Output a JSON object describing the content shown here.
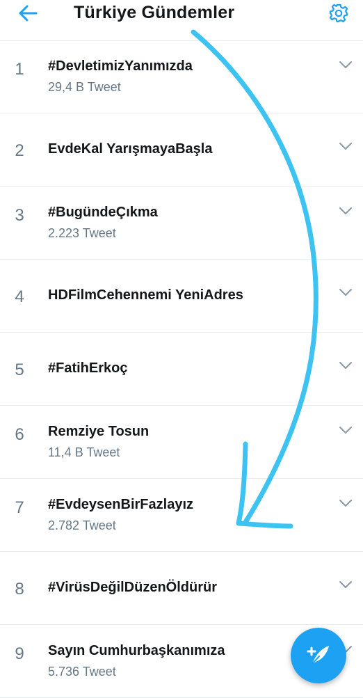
{
  "header": {
    "title": "Türkiye Gündemler",
    "back_icon": "back-arrow-icon",
    "settings_icon": "gear-icon"
  },
  "colors": {
    "accent": "#1da1f2",
    "annotation_stroke": "#3cc3f2",
    "primary_text": "#14171a",
    "secondary_text": "#657786",
    "divider": "#e6ecf0"
  },
  "trends": [
    {
      "rank": "1",
      "name": "#DevletimizYanımızda",
      "count": "29,4 B Tweet"
    },
    {
      "rank": "2",
      "name": "EvdeKal YarışmayaBaşla",
      "count": ""
    },
    {
      "rank": "3",
      "name": "#BugündeÇıkma",
      "count": "2.223 Tweet"
    },
    {
      "rank": "4",
      "name": "HDFilmCehennemi YeniAdres",
      "count": ""
    },
    {
      "rank": "5",
      "name": "#FatihErkoç",
      "count": ""
    },
    {
      "rank": "6",
      "name": "Remziye Tosun",
      "count": "11,4 B Tweet"
    },
    {
      "rank": "7",
      "name": "#EvdeysenBirFazlayız",
      "count": "2.782 Tweet"
    },
    {
      "rank": "8",
      "name": "#VirüsDeğilDüzenÖldürür",
      "count": ""
    },
    {
      "rank": "9",
      "name": "Sayın Cumhurbaşkanımıza",
      "count": "5.736 Tweet"
    }
  ],
  "fab": {
    "icon": "compose-tweet-icon"
  }
}
